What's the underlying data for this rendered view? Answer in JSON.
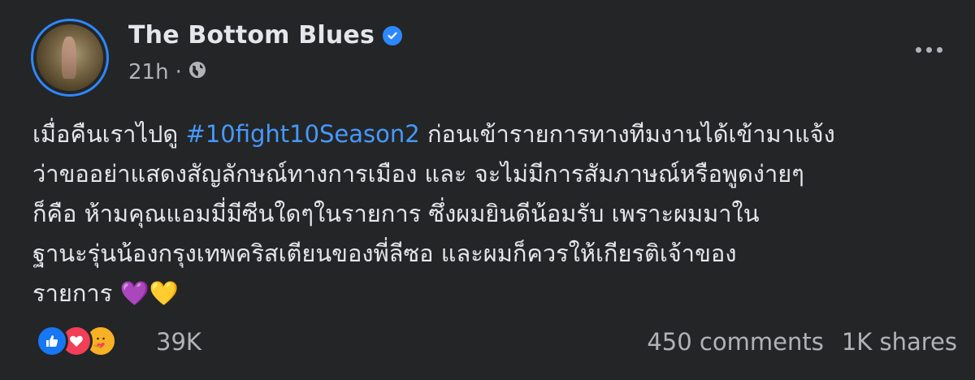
{
  "post": {
    "author": "The Bottom Blues",
    "time": "21h",
    "separator": "·",
    "verified_icon": "verified-badge-icon",
    "privacy_icon": "globe-icon",
    "text_lines": [
      {
        "pre": "เมื่อคืนเราไปดู ",
        "hashtag": "#10fight10Season2",
        "post": " ก่อนเข้ารายการทางทีมงานได้เข้ามาแจ้ง"
      },
      {
        "pre": "ว่าขออย่าแสดงสัญลักษณ์ทางการเมือง และ จะไม่มีการสัมภาษณ์หรือพูดง่ายๆ"
      },
      {
        "pre": "ก็คือ ห้ามคุณแอมมี่มีซีนใดๆในรายการ ซึ่งผมยินดีน้อมรับ เพราะผมมาใน"
      },
      {
        "pre": "ฐานะรุ่นน้องกรุงเทพคริสเตียนของพี่ลีซอ และผมก็ควรให้เกียรติเจ้าของ"
      },
      {
        "pre": "รายการ ",
        "emoji": "💜💛"
      }
    ]
  },
  "stats": {
    "reactions_count": "39K",
    "comments": "450 comments",
    "shares": "1K shares",
    "reaction_icons": [
      "like-icon",
      "love-icon",
      "care-icon"
    ]
  },
  "colors": {
    "background": "#242526",
    "text": "#e4e6eb",
    "secondary": "#b0b3b8",
    "hashtag": "#4599ff",
    "verified": "#2d88ff"
  }
}
